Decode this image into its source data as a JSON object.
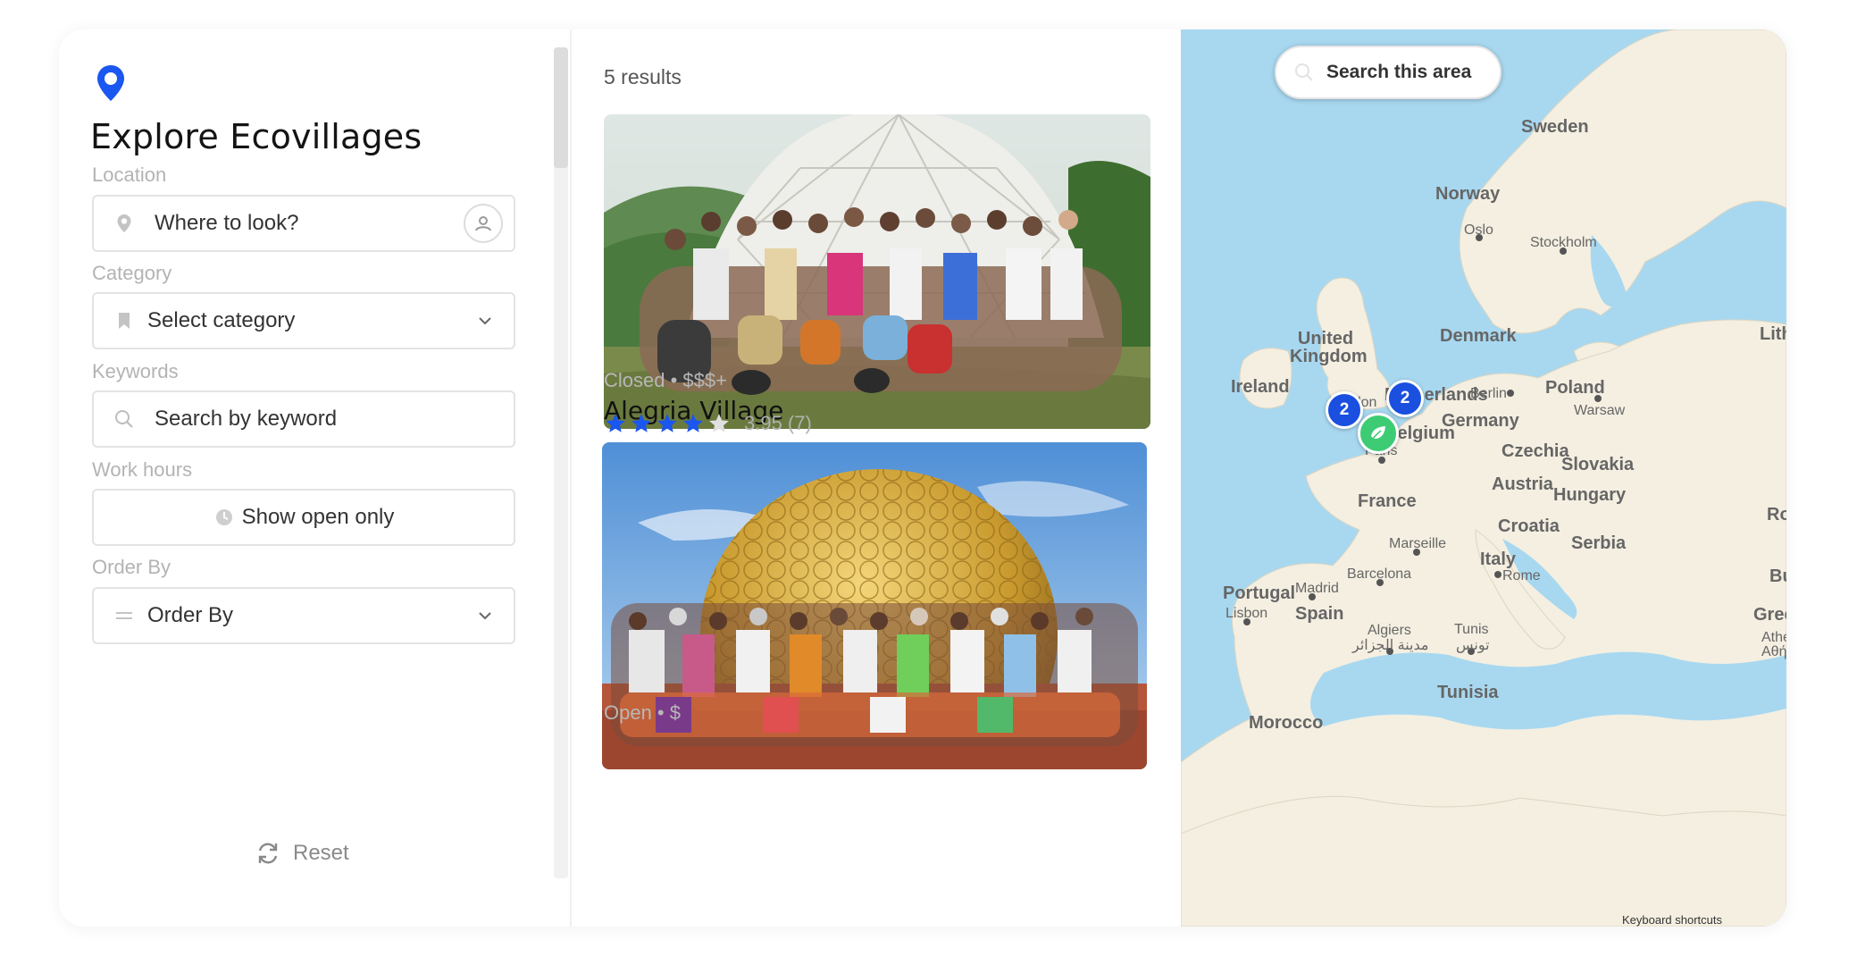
{
  "sidebar": {
    "title": "Explore Ecovillages",
    "location": {
      "label": "Location",
      "placeholder": "Where to look?"
    },
    "category": {
      "label": "Category",
      "value": "Select category"
    },
    "keywords": {
      "label": "Keywords",
      "placeholder": "Search by keyword"
    },
    "work_hours": {
      "label": "Work hours",
      "toggle": "Show open only"
    },
    "order_by": {
      "label": "Order By",
      "value": "Order By"
    },
    "reset_label": "Reset"
  },
  "results": {
    "count": "5 results",
    "items": [
      {
        "status": "Closed • $$$+",
        "name": "Alegria Village",
        "rating_text": "3.95 (7)",
        "stars": 4
      },
      {
        "status": "Open • $"
      }
    ]
  },
  "map": {
    "search_button": "Search this area",
    "keyboard_shortcuts": "Keyboard shortcuts",
    "clusters": [
      "2",
      "2"
    ],
    "labels": {
      "sweden": "Sweden",
      "norway": "Norway",
      "oslo": "Oslo",
      "stockholm": "Stockholm",
      "denmark": "Denmark",
      "lithuania": "Lithu",
      "united_kingdom": "United Kingdom",
      "ireland": "Ireland",
      "london": "London",
      "netherlands": "Netherlands",
      "berlin": "Berlin",
      "poland": "Poland",
      "warsaw": "Warsaw",
      "germany": "Germany",
      "belgium": "Belgium",
      "paris": "Paris",
      "czechia": "Czechia",
      "slovakia": "Slovakia",
      "austria": "Austria",
      "hungary": "Hungary",
      "france": "France",
      "romania": "Ro",
      "croatia": "Croatia",
      "serbia": "Serbia",
      "marseille": "Marseille",
      "italy": "Italy",
      "barcelona": "Barcelona",
      "rome": "Rome",
      "bulgaria": "Bu",
      "portugal": "Portugal",
      "madrid": "Madrid",
      "lisbon": "Lisbon",
      "spain": "Spain",
      "greece": "Greec",
      "athens": "Athe",
      "athens_ar": "Αθή",
      "algiers": "Algiers",
      "algiers_ar": "مدينة الجزائر",
      "tunis": "Tunis",
      "tunis_ar": "تونس",
      "tunisia": "Tunisia",
      "morocco": "Morocco"
    }
  },
  "colors": {
    "accent": "#1a4fe0",
    "marker_green": "#3dcc74",
    "water": "#a8d8f0",
    "land": "#f4efe1"
  }
}
